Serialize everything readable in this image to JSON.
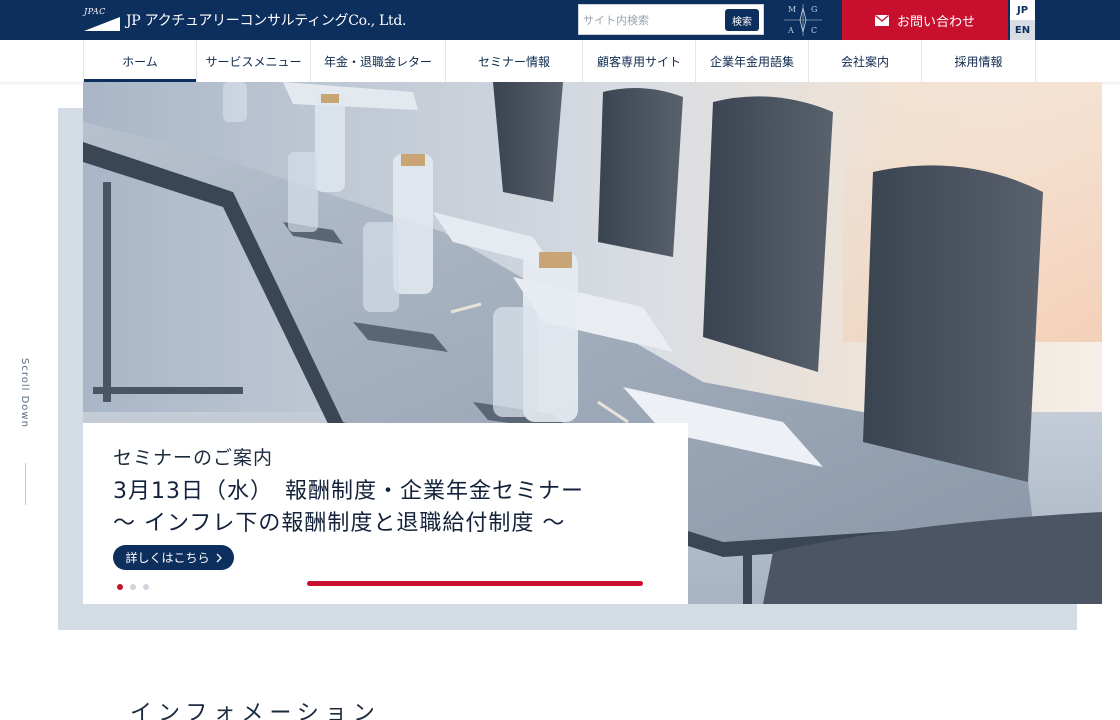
{
  "header": {
    "logo_small": "JPAC",
    "logo_text": "JP アクチュアリーコンサルティングCo., Ltd.",
    "search_placeholder": "サイト内検索",
    "search_button": "検索",
    "mgac_letters": [
      "M",
      "G",
      "A",
      "C"
    ],
    "contact_label": "お問い合わせ",
    "lang_jp": "JP",
    "lang_en": "EN"
  },
  "nav": {
    "items": [
      {
        "label": "ホーム",
        "active": true
      },
      {
        "label": "サービスメニュー"
      },
      {
        "label": "年金・退職金レター"
      },
      {
        "label": "セミナー情報"
      },
      {
        "label": "顧客専用サイト"
      },
      {
        "label": "企業年金用語集"
      },
      {
        "label": "会社案内"
      },
      {
        "label": "採用情報"
      }
    ]
  },
  "hero": {
    "category": "セミナーのご案内",
    "title_line1": "3月13日（水）　報酬制度・企業年金セミナー",
    "title_line2": "〜 インフレ下の報酬制度と退職給付制度 〜",
    "more_label": "詳しくはこちら",
    "slide_count": 3,
    "active_slide": 1,
    "scroll_label": "Scroll Down"
  },
  "info": {
    "heading": "インフォメーション"
  },
  "colors": {
    "navy": "#0d2f5e",
    "red": "#c8102e",
    "hero_bg": "#d3dce5"
  }
}
